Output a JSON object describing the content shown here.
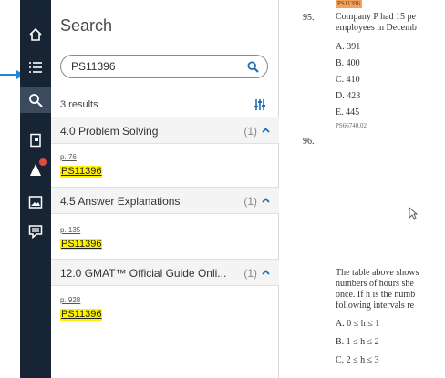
{
  "rail": {
    "items": [
      {
        "name": "home-icon"
      },
      {
        "name": "table-of-contents-icon"
      },
      {
        "name": "search-icon"
      },
      {
        "name": "bookmark-icon"
      },
      {
        "name": "flag-icon"
      },
      {
        "name": "image-icon"
      },
      {
        "name": "notes-icon"
      }
    ],
    "active": "search-icon"
  },
  "search": {
    "title": "Search",
    "query": "PS11396",
    "results_count": "3 results",
    "groups": [
      {
        "title": "4.0 Problem Solving",
        "count": "(1)",
        "page": "p. 76",
        "term": "PS11396"
      },
      {
        "title": "4.5 Answer Explanations",
        "count": "(1)",
        "page": "p. 135",
        "term": "PS11396"
      },
      {
        "title": "12.0 GMAT™ Official Guide Onli...",
        "count": "(1)",
        "page": "p. 928",
        "term": "PS11396"
      }
    ]
  },
  "document": {
    "top_tag": "PS11396",
    "q95_number": "95.",
    "q95_line1": "Company P had 15 pe",
    "q95_line2": "employees in Decemb",
    "options": [
      "A. 391",
      "B. 400",
      "C. 410",
      "D. 423",
      "E. 445"
    ],
    "q95_code": "PS66740.02",
    "q96_number": "96.",
    "q96_lines": [
      "The table above shows",
      "numbers of hours she",
      "once. If h is the numb",
      "following intervals re"
    ],
    "q96_options": [
      "A. 0 ≤ h ≤ 1",
      "B. 1 ≤ h ≤ 2",
      "C. 2 ≤ h ≤ 3"
    ]
  },
  "colors": {
    "rail": "#172433",
    "highlight": "#fff200",
    "accent": "#1b6fb5",
    "pointer": "#1e88d4"
  }
}
